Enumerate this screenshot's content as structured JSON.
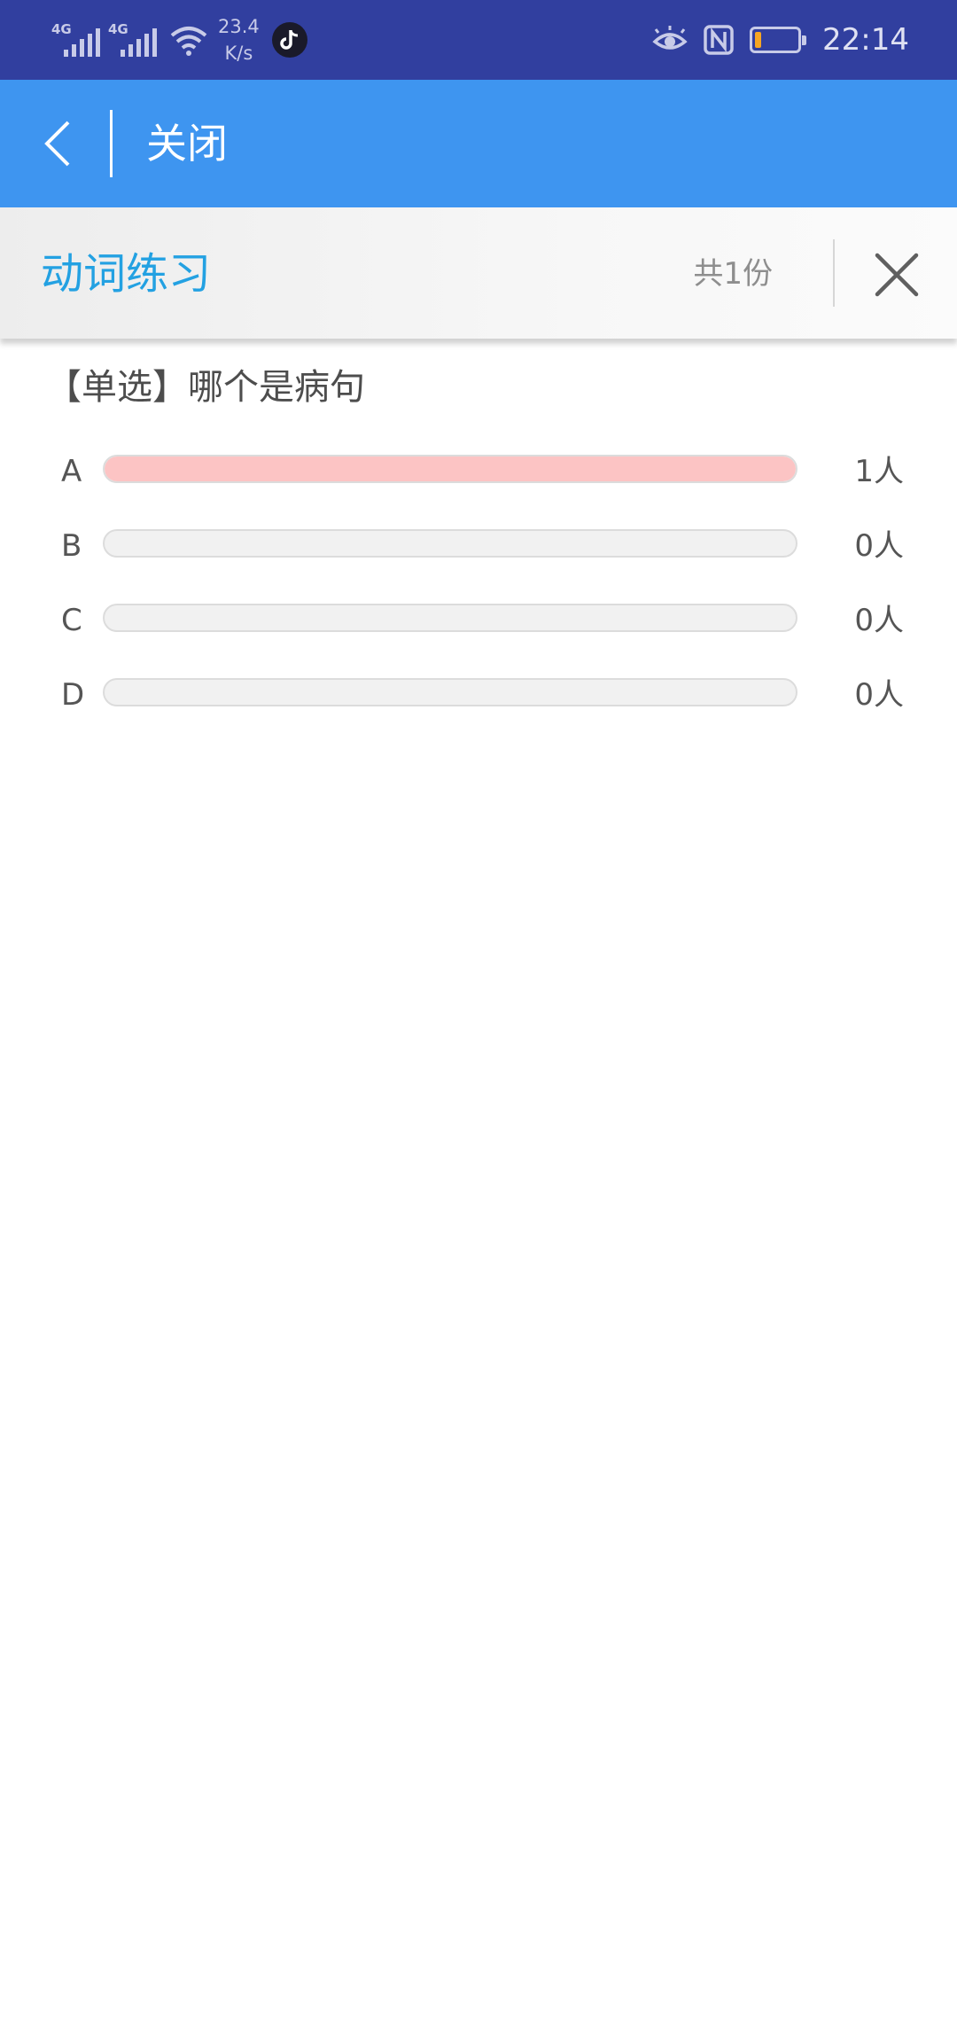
{
  "status_bar": {
    "signal1_label": "4G",
    "signal2_label": "4G",
    "speed_value": "23.4",
    "speed_unit": "K/s",
    "time": "22:14",
    "battery_fraction": 0.15
  },
  "app_bar": {
    "close_label": "关闭"
  },
  "header": {
    "title": "动词练习",
    "count": "共1份"
  },
  "question": {
    "text": "【单选】哪个是病句",
    "options": [
      {
        "letter": "A",
        "count": "1人",
        "fraction": 1.0,
        "color": "#fcc4c4"
      },
      {
        "letter": "B",
        "count": "0人",
        "fraction": 0,
        "color": "#fcc4c4"
      },
      {
        "letter": "C",
        "count": "0人",
        "fraction": 0,
        "color": "#fcc4c4"
      },
      {
        "letter": "D",
        "count": "0人",
        "fraction": 0,
        "color": "#fcc4c4"
      }
    ]
  },
  "colors": {
    "status_bar": "#313f9f",
    "app_bar": "#3e95f0",
    "title_accent": "#23a1e2"
  }
}
